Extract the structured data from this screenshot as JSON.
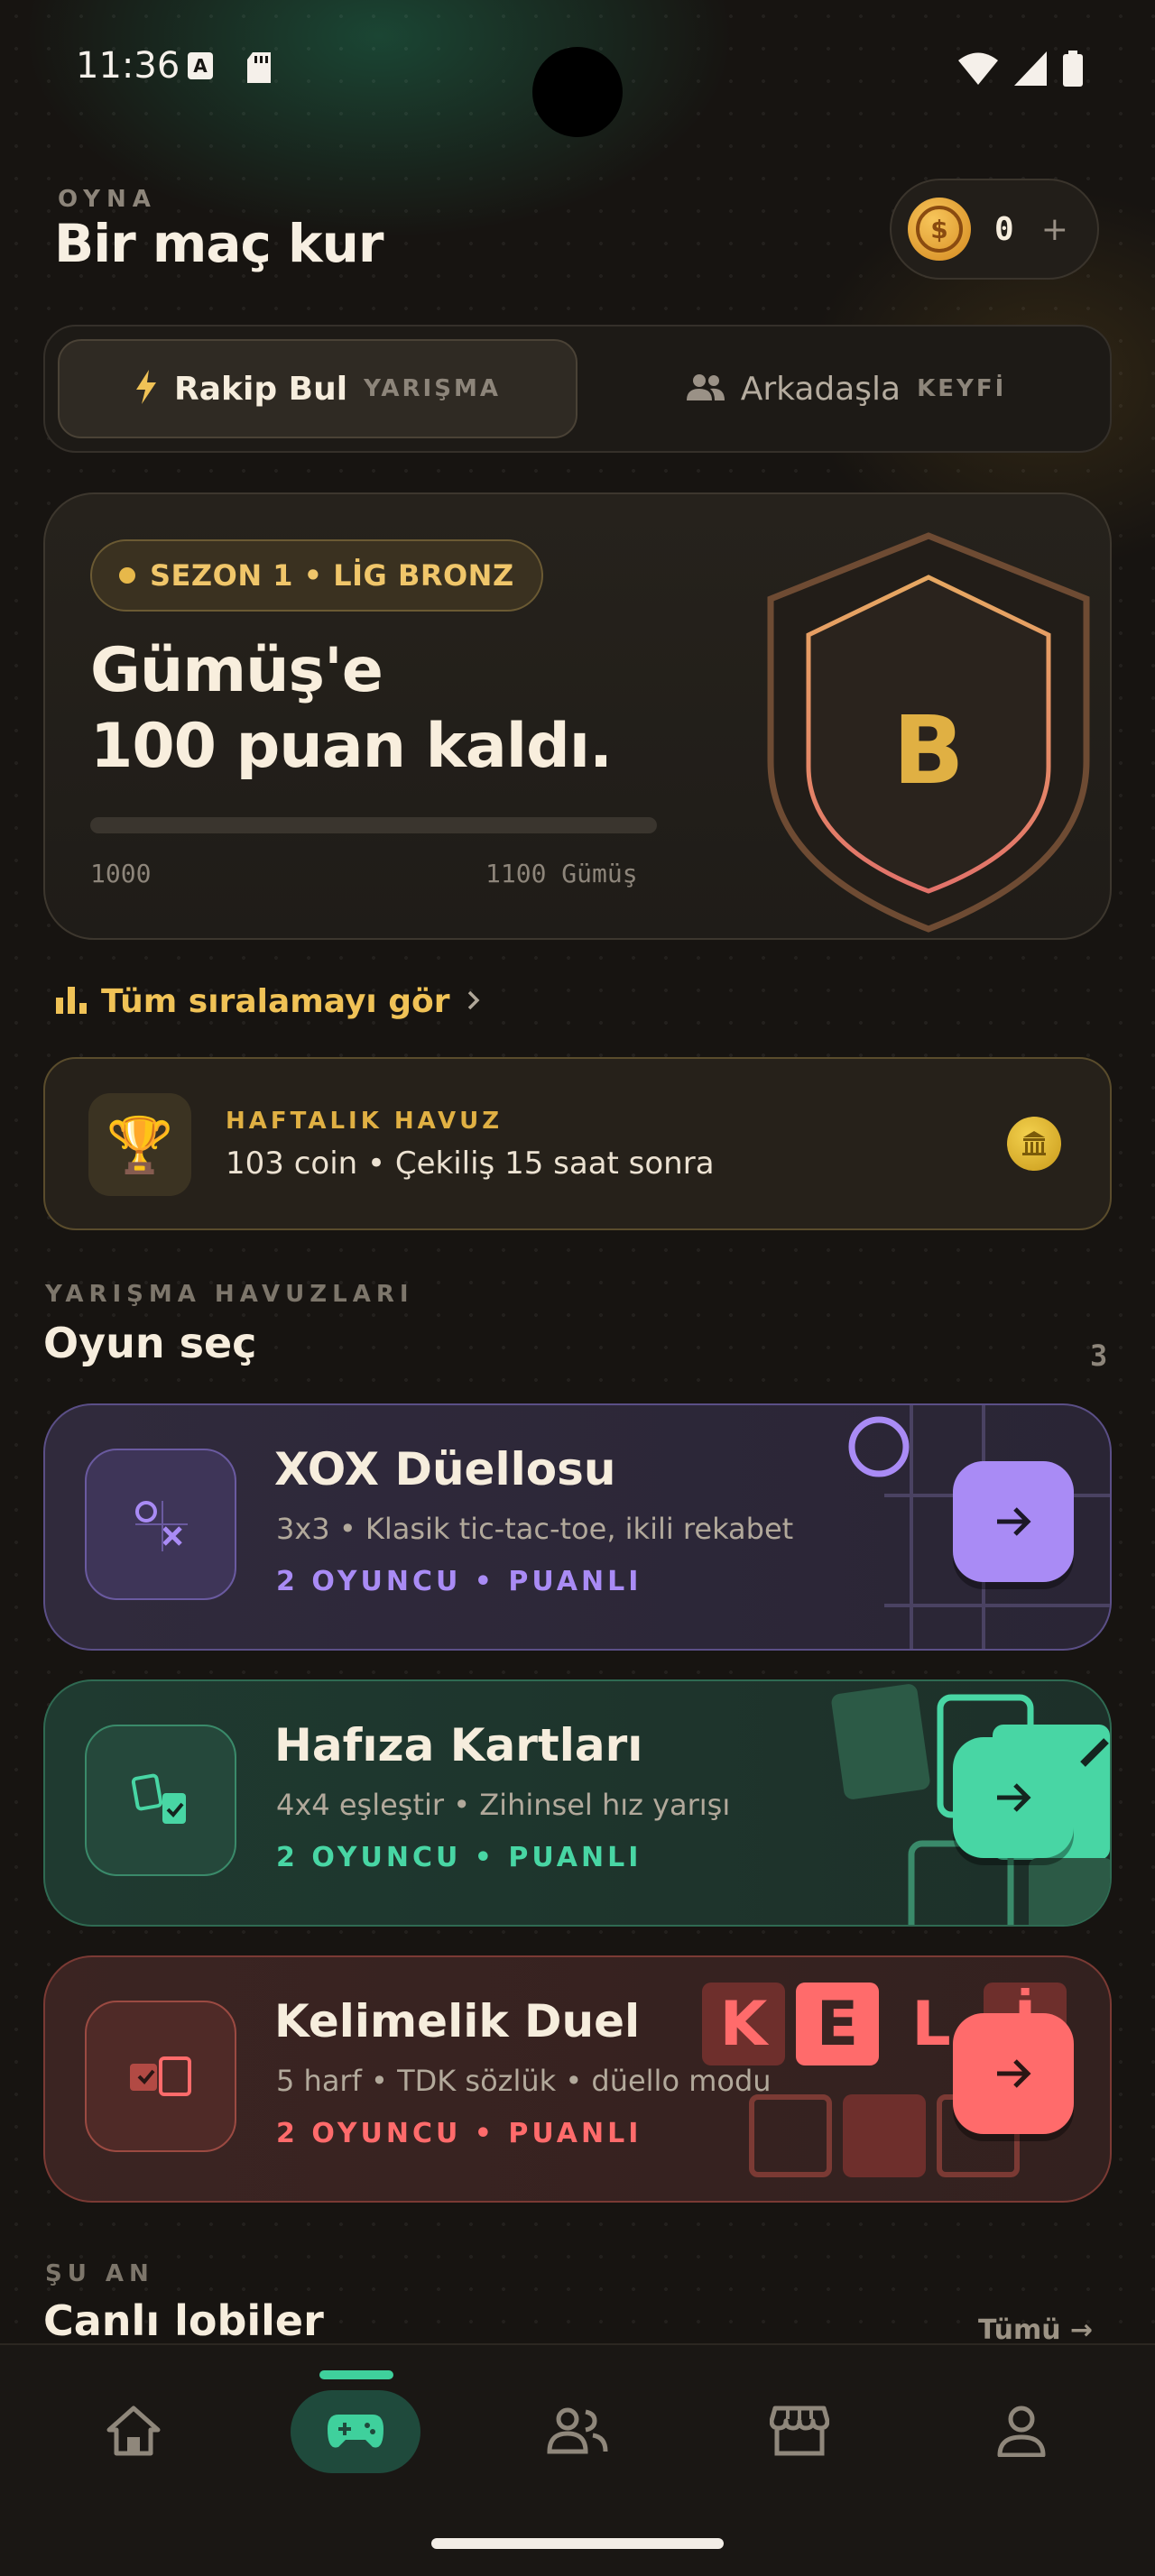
{
  "status_bar": {
    "time": "11:36",
    "left_icons": [
      "a-notification-icon",
      "sd-card-icon"
    ],
    "right_icons": [
      "wifi-icon",
      "signal-icon",
      "battery-icon"
    ]
  },
  "header": {
    "eyebrow": "OYNA",
    "title": "Bir maç kur",
    "coin_balance": "0",
    "coin_plus": "+"
  },
  "mode_switch": {
    "active": {
      "label": "Rakip Bul",
      "tag": "YARIŞMA",
      "icon": "bolt-icon"
    },
    "inactive": {
      "label": "Arkadaşla",
      "tag": "KEYFİ",
      "icon": "people-icon"
    }
  },
  "league": {
    "season_badge": "SEZON 1 • LİG BRONZ",
    "headline_line1": "Gümüş'e",
    "headline_line2": "100 puan kaldı.",
    "progress_fraction": 0.0,
    "range_start": "1000",
    "range_end": "1100 Gümüş",
    "shield_letter": "B",
    "colors": {
      "gold": "#e0b043",
      "shield_stroke": "#e58f6a"
    }
  },
  "ranking_link": "Tüm sıralamayı gör",
  "weekly_pool": {
    "eyebrow": "HAFTALIK HAVUZ",
    "text": "103 coin • Çekiliş 15 saat sonra",
    "icon": "trophy-icon",
    "trophy_glyph": "🏆"
  },
  "games_section": {
    "eyebrow": "YARIŞMA HAVUZLARI",
    "title": "Oyun seç",
    "count": "3",
    "games": [
      {
        "title": "XOX Düellosu",
        "subtitle": "3x3 • Klasik tic-tac-toe, ikili rekabet",
        "tag": "2 OYUNCU • PUANLI",
        "accent": "#a98bf5"
      },
      {
        "title": "Hafıza Kartları",
        "subtitle": "4x4 eşleştir • Zihinsel hız yarışı",
        "tag": "2 OYUNCU • PUANLI",
        "accent": "#48d6a4"
      },
      {
        "title": "Kelimelik Duel",
        "subtitle": "5 harf • TDK sözlük • düello modu",
        "tag": "2 OYUNCU • PUANLI",
        "accent": "#ff6b6b",
        "letters": [
          "K",
          "E",
          "L",
          "İ"
        ]
      }
    ]
  },
  "live_section": {
    "eyebrow": "ŞU AN",
    "title": "Canlı lobiler",
    "see_all": "Tümü →"
  },
  "bottom_nav": {
    "items": [
      "home-icon",
      "gamepad-icon",
      "friends-icon",
      "store-icon",
      "profile-icon"
    ],
    "active_index": 1,
    "active_color": "#3fd09c"
  }
}
